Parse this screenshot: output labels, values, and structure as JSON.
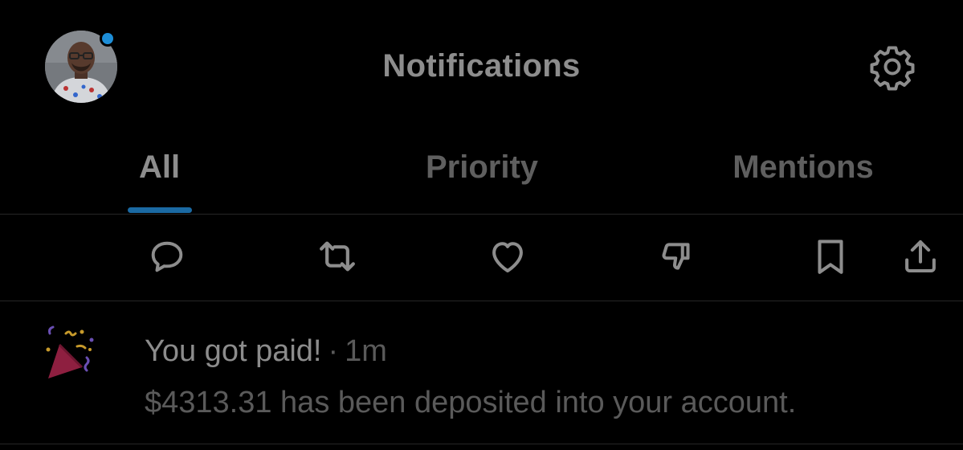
{
  "header": {
    "title": "Notifications",
    "avatar_icon": "user-avatar",
    "settings_icon": "gear-icon"
  },
  "tabs": [
    {
      "label": "All",
      "active": true
    },
    {
      "label": "Priority",
      "active": false
    },
    {
      "label": "Mentions",
      "active": false
    }
  ],
  "actions": [
    {
      "icon": "reply-icon"
    },
    {
      "icon": "retweet-icon"
    },
    {
      "icon": "like-icon"
    },
    {
      "icon": "dislike-icon"
    },
    {
      "icon": "bookmark-icon"
    },
    {
      "icon": "share-icon"
    }
  ],
  "notification": {
    "icon": "party-popper-icon",
    "title": "You got paid!",
    "separator": "·",
    "time": "1m",
    "body": "$4313.31 has been deposited into your account."
  },
  "colors": {
    "background": "#000000",
    "accent": "#1b6aa3",
    "unread_dot": "#1d8ed8"
  }
}
